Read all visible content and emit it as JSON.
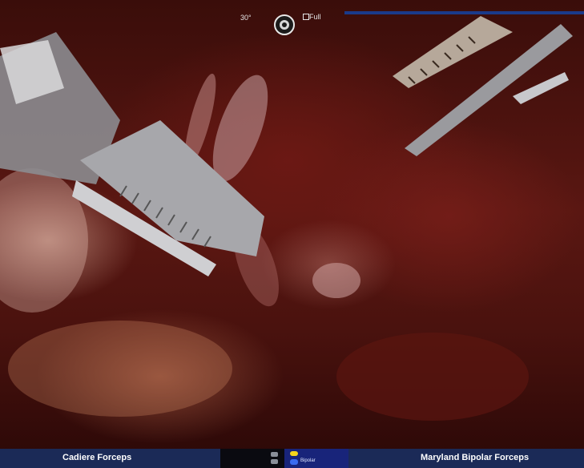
{
  "overlay": {
    "scope_angle": "30°",
    "scope_mode": "Full",
    "icons": {
      "camera": "camera-lens-icon",
      "mode": "mode-square-icon"
    }
  },
  "instruments": {
    "left": {
      "name": "Cadiere Forceps"
    },
    "right": {
      "name": "Maryland Bipolar Forceps",
      "energy_label": "Bipolar"
    }
  },
  "colors": {
    "panel_blue": "#1b2a57",
    "energy_blue": "#18247a",
    "pedal_yellow": "#f4d41c",
    "pedal_blue": "#3a6bf0"
  }
}
